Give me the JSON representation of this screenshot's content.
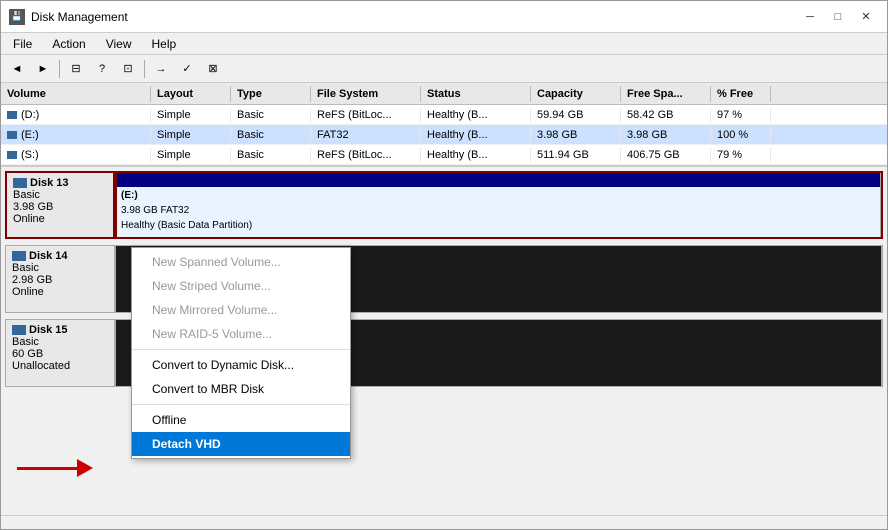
{
  "window": {
    "title": "Disk Management",
    "icon": "💾"
  },
  "titlebar": {
    "title": "Disk Management",
    "minimize": "─",
    "maximize": "□",
    "close": "✕"
  },
  "menubar": {
    "items": [
      {
        "label": "File"
      },
      {
        "label": "Action"
      },
      {
        "label": "View"
      },
      {
        "label": "Help"
      }
    ]
  },
  "toolbar": {
    "buttons": [
      "◄",
      "►",
      "⊟",
      "?",
      "⊡",
      "→",
      "✓",
      "⊠"
    ]
  },
  "table": {
    "headers": [
      "Volume",
      "Layout",
      "Type",
      "File System",
      "Status",
      "Capacity",
      "Free Spa...",
      "% Free"
    ],
    "rows": [
      {
        "volume": "(D:)",
        "layout": "Simple",
        "type": "Basic",
        "filesystem": "ReFS (BitLoc...",
        "status": "Healthy (B...",
        "capacity": "59.94 GB",
        "freespace": "58.42 GB",
        "pctfree": "97 %",
        "iconColor": "#336699"
      },
      {
        "volume": "(E:)",
        "layout": "Simple",
        "type": "Basic",
        "filesystem": "FAT32",
        "status": "Healthy (B...",
        "capacity": "3.98 GB",
        "freespace": "3.98 GB",
        "pctfree": "100 %",
        "iconColor": "#336699"
      },
      {
        "volume": "(S:)",
        "layout": "Simple",
        "type": "Basic",
        "filesystem": "ReFS (BitLoc...",
        "status": "Healthy (B...",
        "capacity": "511.94 GB",
        "freespace": "406.75 GB",
        "pctfree": "79 %",
        "iconColor": "#336699"
      }
    ]
  },
  "disks": [
    {
      "id": "disk13",
      "label": "Disk 13",
      "type": "Basic",
      "size": "3.98 GB",
      "status": "Online",
      "selected": true,
      "partitions": [
        {
          "type": "header_blue",
          "label": "(E:)",
          "sublabel": "3.98 GB FAT32",
          "status": "Healthy (Basic Data Partition)",
          "style": "fat32",
          "flex": 1
        }
      ]
    },
    {
      "id": "disk14",
      "label": "Disk 14",
      "type": "Basic",
      "size": "2.98 GB",
      "status": "Online",
      "selected": false,
      "partitions": [
        {
          "type": "unallocated",
          "label": "",
          "style": "unallocated",
          "flex": 1
        }
      ]
    },
    {
      "id": "disk15",
      "label": "Disk 15",
      "type": "Basic",
      "size": "60 GB",
      "status": "Unallocated",
      "selected": false,
      "partitions": [
        {
          "type": "unallocated",
          "label": "",
          "style": "unallocated",
          "flex": 1
        }
      ]
    }
  ],
  "contextMenu": {
    "items": [
      {
        "label": "New Spanned Volume...",
        "disabled": true
      },
      {
        "label": "New Striped Volume...",
        "disabled": true
      },
      {
        "label": "New Mirrored Volume...",
        "disabled": true
      },
      {
        "label": "New RAID-5 Volume...",
        "disabled": true
      },
      {
        "separator": true
      },
      {
        "label": "Convert to Dynamic Disk...",
        "disabled": false
      },
      {
        "label": "Convert to MBR Disk",
        "disabled": false
      },
      {
        "separator": true
      },
      {
        "label": "Offline",
        "disabled": false
      },
      {
        "label": "Detach VHD",
        "disabled": false,
        "highlighted": true
      }
    ]
  },
  "arrow": {
    "color": "#cc0000"
  }
}
